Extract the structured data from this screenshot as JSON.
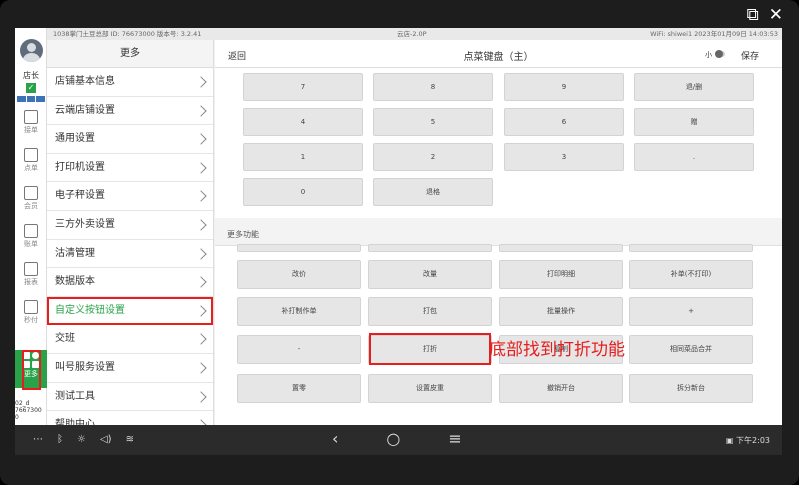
{
  "status_bar": {
    "left": "1038掌门土豆总部 ID: 76673000  版本号: 3.2.41",
    "center": "云店-2.0P",
    "right": "WiFi: shiwei1  2023年01月09日 14:03:53"
  },
  "left_nav": {
    "role": "店长",
    "items": [
      {
        "label": "接单",
        "icon": "inbox-icon"
      },
      {
        "label": "点单",
        "icon": "order-icon"
      },
      {
        "label": "会员",
        "icon": "member-icon"
      },
      {
        "label": "账单",
        "icon": "bill-icon"
      },
      {
        "label": "报表",
        "icon": "report-icon"
      },
      {
        "label": "秒付",
        "icon": "pay-icon"
      },
      {
        "label": "更多",
        "icon": "more-icon"
      }
    ],
    "device_id": "02_d\n7667300\n0"
  },
  "menu": {
    "title": "更多",
    "items": [
      "店铺基本信息",
      "云端店铺设置",
      "通用设置",
      "打印机设置",
      "电子秤设置",
      "三方外卖设置",
      "沽清管理",
      "数据版本",
      "自定义按钮设置",
      "交班",
      "叫号服务设置",
      "测试工具",
      "帮助中心"
    ]
  },
  "header": {
    "back": "返回",
    "title": "点菜键盘（主）",
    "size_label": "小",
    "save": "保存"
  },
  "keypad": [
    "7",
    "8",
    "9",
    "退/删",
    "4",
    "5",
    "6",
    "赠",
    "1",
    "2",
    "3",
    ".",
    "0",
    "退格"
  ],
  "more_section": "更多功能",
  "funcs": [
    "改价",
    "改量",
    "打印明细",
    "补单(不打印)",
    "补打制作单",
    "打包",
    "批量操作",
    "+",
    "-",
    "打折",
    "复制",
    "相同菜品合并",
    "置零",
    "设置皮重",
    "撤销开台",
    "拆分新台"
  ],
  "annotation": "底部找到打折功能",
  "sysnav": {
    "time": "下午2:03"
  }
}
